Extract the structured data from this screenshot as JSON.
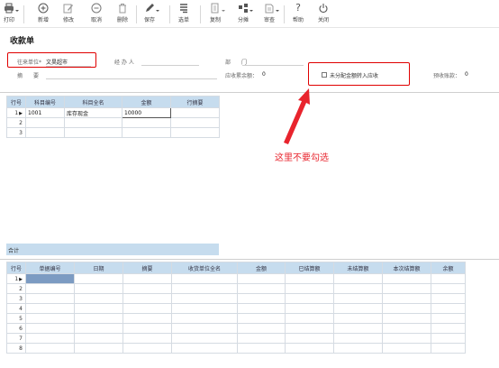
{
  "toolbar": {
    "print": "打印",
    "new": "新增",
    "edit": "修改",
    "cancel": "取消",
    "delete": "删除",
    "save": "保存",
    "select_doc": "选单",
    "copy": "复制",
    "distribute": "分摊",
    "audit": "审查",
    "help": "帮助",
    "close": "关闭"
  },
  "page": {
    "title": "收款单"
  },
  "header": {
    "customer_label": "往来单位*",
    "customer_value": "文昊超市",
    "handler_label": "经 办 人",
    "department_label": "部　　门",
    "memo_label": "摘　　要",
    "receivable_label": "应收累余额：",
    "receivable_value": "0",
    "unallocated_label": "未分配金额转入应收",
    "prepaid_label": "预收账款：",
    "prepaid_value": "0"
  },
  "account_grid": {
    "headers": [
      "行号",
      "科目编号",
      "科目全名",
      "金额",
      "行摘要"
    ],
    "rows": [
      {
        "num": "1",
        "code": "1001",
        "name": "库存现金",
        "amount": "10000",
        "memo": ""
      },
      {
        "num": "2",
        "code": "",
        "name": "",
        "amount": "",
        "memo": ""
      },
      {
        "num": "3",
        "code": "",
        "name": "",
        "amount": "",
        "memo": ""
      }
    ],
    "total_label": "合计"
  },
  "annotation": {
    "text": "这里不要勾选",
    "color": "#e8242d"
  },
  "settlement_grid": {
    "headers": [
      "行号",
      "单据编号",
      "日期",
      "摘要",
      "收货单位全名",
      "金额",
      "已结算额",
      "未结算额",
      "本次结算额",
      "余额"
    ],
    "row_numbers": [
      "1",
      "2",
      "3",
      "4",
      "5",
      "6",
      "7",
      "8"
    ]
  }
}
